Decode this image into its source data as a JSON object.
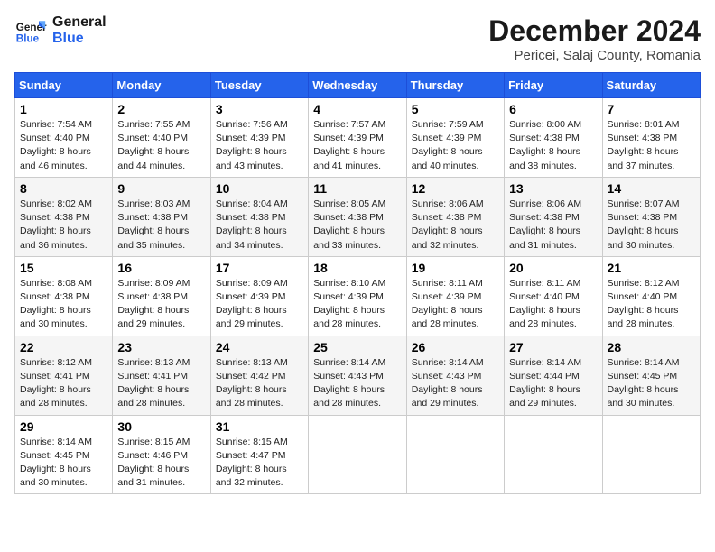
{
  "header": {
    "logo_line1": "General",
    "logo_line2": "Blue",
    "month": "December 2024",
    "location": "Pericei, Salaj County, Romania"
  },
  "weekdays": [
    "Sunday",
    "Monday",
    "Tuesday",
    "Wednesday",
    "Thursday",
    "Friday",
    "Saturday"
  ],
  "weeks": [
    [
      {
        "day": "1",
        "sunrise": "7:54 AM",
        "sunset": "4:40 PM",
        "daylight": "8 hours and 46 minutes."
      },
      {
        "day": "2",
        "sunrise": "7:55 AM",
        "sunset": "4:40 PM",
        "daylight": "8 hours and 44 minutes."
      },
      {
        "day": "3",
        "sunrise": "7:56 AM",
        "sunset": "4:39 PM",
        "daylight": "8 hours and 43 minutes."
      },
      {
        "day": "4",
        "sunrise": "7:57 AM",
        "sunset": "4:39 PM",
        "daylight": "8 hours and 41 minutes."
      },
      {
        "day": "5",
        "sunrise": "7:59 AM",
        "sunset": "4:39 PM",
        "daylight": "8 hours and 40 minutes."
      },
      {
        "day": "6",
        "sunrise": "8:00 AM",
        "sunset": "4:38 PM",
        "daylight": "8 hours and 38 minutes."
      },
      {
        "day": "7",
        "sunrise": "8:01 AM",
        "sunset": "4:38 PM",
        "daylight": "8 hours and 37 minutes."
      }
    ],
    [
      {
        "day": "8",
        "sunrise": "8:02 AM",
        "sunset": "4:38 PM",
        "daylight": "8 hours and 36 minutes."
      },
      {
        "day": "9",
        "sunrise": "8:03 AM",
        "sunset": "4:38 PM",
        "daylight": "8 hours and 35 minutes."
      },
      {
        "day": "10",
        "sunrise": "8:04 AM",
        "sunset": "4:38 PM",
        "daylight": "8 hours and 34 minutes."
      },
      {
        "day": "11",
        "sunrise": "8:05 AM",
        "sunset": "4:38 PM",
        "daylight": "8 hours and 33 minutes."
      },
      {
        "day": "12",
        "sunrise": "8:06 AM",
        "sunset": "4:38 PM",
        "daylight": "8 hours and 32 minutes."
      },
      {
        "day": "13",
        "sunrise": "8:06 AM",
        "sunset": "4:38 PM",
        "daylight": "8 hours and 31 minutes."
      },
      {
        "day": "14",
        "sunrise": "8:07 AM",
        "sunset": "4:38 PM",
        "daylight": "8 hours and 30 minutes."
      }
    ],
    [
      {
        "day": "15",
        "sunrise": "8:08 AM",
        "sunset": "4:38 PM",
        "daylight": "8 hours and 30 minutes."
      },
      {
        "day": "16",
        "sunrise": "8:09 AM",
        "sunset": "4:38 PM",
        "daylight": "8 hours and 29 minutes."
      },
      {
        "day": "17",
        "sunrise": "8:09 AM",
        "sunset": "4:39 PM",
        "daylight": "8 hours and 29 minutes."
      },
      {
        "day": "18",
        "sunrise": "8:10 AM",
        "sunset": "4:39 PM",
        "daylight": "8 hours and 28 minutes."
      },
      {
        "day": "19",
        "sunrise": "8:11 AM",
        "sunset": "4:39 PM",
        "daylight": "8 hours and 28 minutes."
      },
      {
        "day": "20",
        "sunrise": "8:11 AM",
        "sunset": "4:40 PM",
        "daylight": "8 hours and 28 minutes."
      },
      {
        "day": "21",
        "sunrise": "8:12 AM",
        "sunset": "4:40 PM",
        "daylight": "8 hours and 28 minutes."
      }
    ],
    [
      {
        "day": "22",
        "sunrise": "8:12 AM",
        "sunset": "4:41 PM",
        "daylight": "8 hours and 28 minutes."
      },
      {
        "day": "23",
        "sunrise": "8:13 AM",
        "sunset": "4:41 PM",
        "daylight": "8 hours and 28 minutes."
      },
      {
        "day": "24",
        "sunrise": "8:13 AM",
        "sunset": "4:42 PM",
        "daylight": "8 hours and 28 minutes."
      },
      {
        "day": "25",
        "sunrise": "8:14 AM",
        "sunset": "4:43 PM",
        "daylight": "8 hours and 28 minutes."
      },
      {
        "day": "26",
        "sunrise": "8:14 AM",
        "sunset": "4:43 PM",
        "daylight": "8 hours and 29 minutes."
      },
      {
        "day": "27",
        "sunrise": "8:14 AM",
        "sunset": "4:44 PM",
        "daylight": "8 hours and 29 minutes."
      },
      {
        "day": "28",
        "sunrise": "8:14 AM",
        "sunset": "4:45 PM",
        "daylight": "8 hours and 30 minutes."
      }
    ],
    [
      {
        "day": "29",
        "sunrise": "8:14 AM",
        "sunset": "4:45 PM",
        "daylight": "8 hours and 30 minutes."
      },
      {
        "day": "30",
        "sunrise": "8:15 AM",
        "sunset": "4:46 PM",
        "daylight": "8 hours and 31 minutes."
      },
      {
        "day": "31",
        "sunrise": "8:15 AM",
        "sunset": "4:47 PM",
        "daylight": "8 hours and 32 minutes."
      },
      null,
      null,
      null,
      null
    ]
  ],
  "labels": {
    "sunrise": "Sunrise: ",
    "sunset": "Sunset: ",
    "daylight": "Daylight: "
  }
}
